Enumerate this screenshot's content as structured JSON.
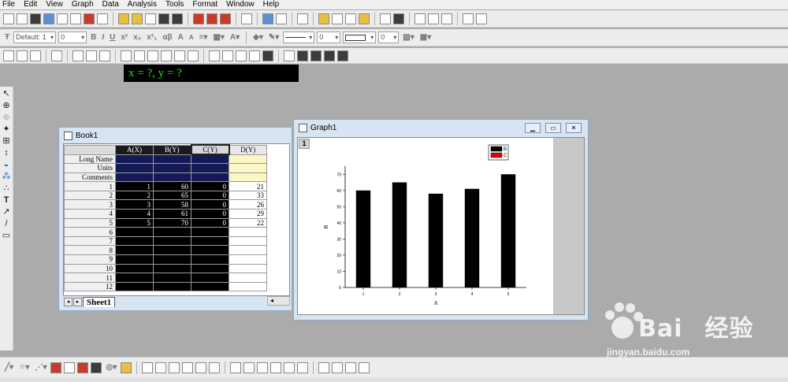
{
  "menu": {
    "items": [
      "File",
      "Edit",
      "View",
      "Graph",
      "Data",
      "Analysis",
      "Tools",
      "Format",
      "Window",
      "Help"
    ]
  },
  "format_toolbar": {
    "font_name": "Default: 1",
    "font_size": "0",
    "bold": "B",
    "italic": "I",
    "underline": "U",
    "superscript": "x²",
    "subscript": "x₂",
    "supersub": "x²₁",
    "greek": "αβ",
    "size_up": "A",
    "size_down": "A",
    "line_width": "0",
    "symbol_size": "0"
  },
  "status": {
    "readout": "x = ?, y = ?"
  },
  "book": {
    "title": "Book1",
    "sheet_tab": "Sheet1",
    "columns": [
      "A(X)",
      "B(Y)",
      "C(Y)",
      "D(Y)"
    ],
    "meta_rows": [
      "Long Name",
      "Units",
      "Comments"
    ],
    "row_numbers": [
      "1",
      "2",
      "3",
      "4",
      "5",
      "6",
      "7",
      "8",
      "9",
      "10",
      "11",
      "12"
    ],
    "rows": [
      [
        "1",
        "60",
        "0",
        "21"
      ],
      [
        "2",
        "65",
        "0",
        "33"
      ],
      [
        "3",
        "58",
        "0",
        "26"
      ],
      [
        "4",
        "61",
        "0",
        "29"
      ],
      [
        "5",
        "70",
        "0",
        "22"
      ],
      [
        "",
        "",
        "",
        ""
      ],
      [
        "",
        "",
        "",
        ""
      ],
      [
        "",
        "",
        "",
        ""
      ],
      [
        "",
        "",
        "",
        ""
      ],
      [
        "",
        "",
        "",
        ""
      ],
      [
        "",
        "",
        "",
        ""
      ],
      [
        "",
        "",
        "",
        ""
      ]
    ]
  },
  "graph": {
    "title": "Graph1",
    "layer_label": "1",
    "legend": [
      {
        "label": "B",
        "color": "#000000"
      },
      {
        "label": "C",
        "color": "#e00000"
      }
    ]
  },
  "chart_data": {
    "type": "bar",
    "categories": [
      "1",
      "2",
      "3",
      "4",
      "5"
    ],
    "series": [
      {
        "name": "B",
        "values": [
          60,
          65,
          58,
          61,
          70
        ]
      },
      {
        "name": "C",
        "values": [
          0,
          0,
          0,
          0,
          0
        ]
      }
    ],
    "xlabel": "A",
    "ylabel": "B",
    "ylim": [
      0,
      75
    ],
    "yticks": [
      "0",
      "10",
      "20",
      "30",
      "40",
      "50",
      "60",
      "70"
    ],
    "grid": false,
    "legend_position": "top-right"
  },
  "watermark": {
    "brand": "Bai",
    "brand_rest": "经验",
    "url": "jingyan.baidu.com"
  }
}
